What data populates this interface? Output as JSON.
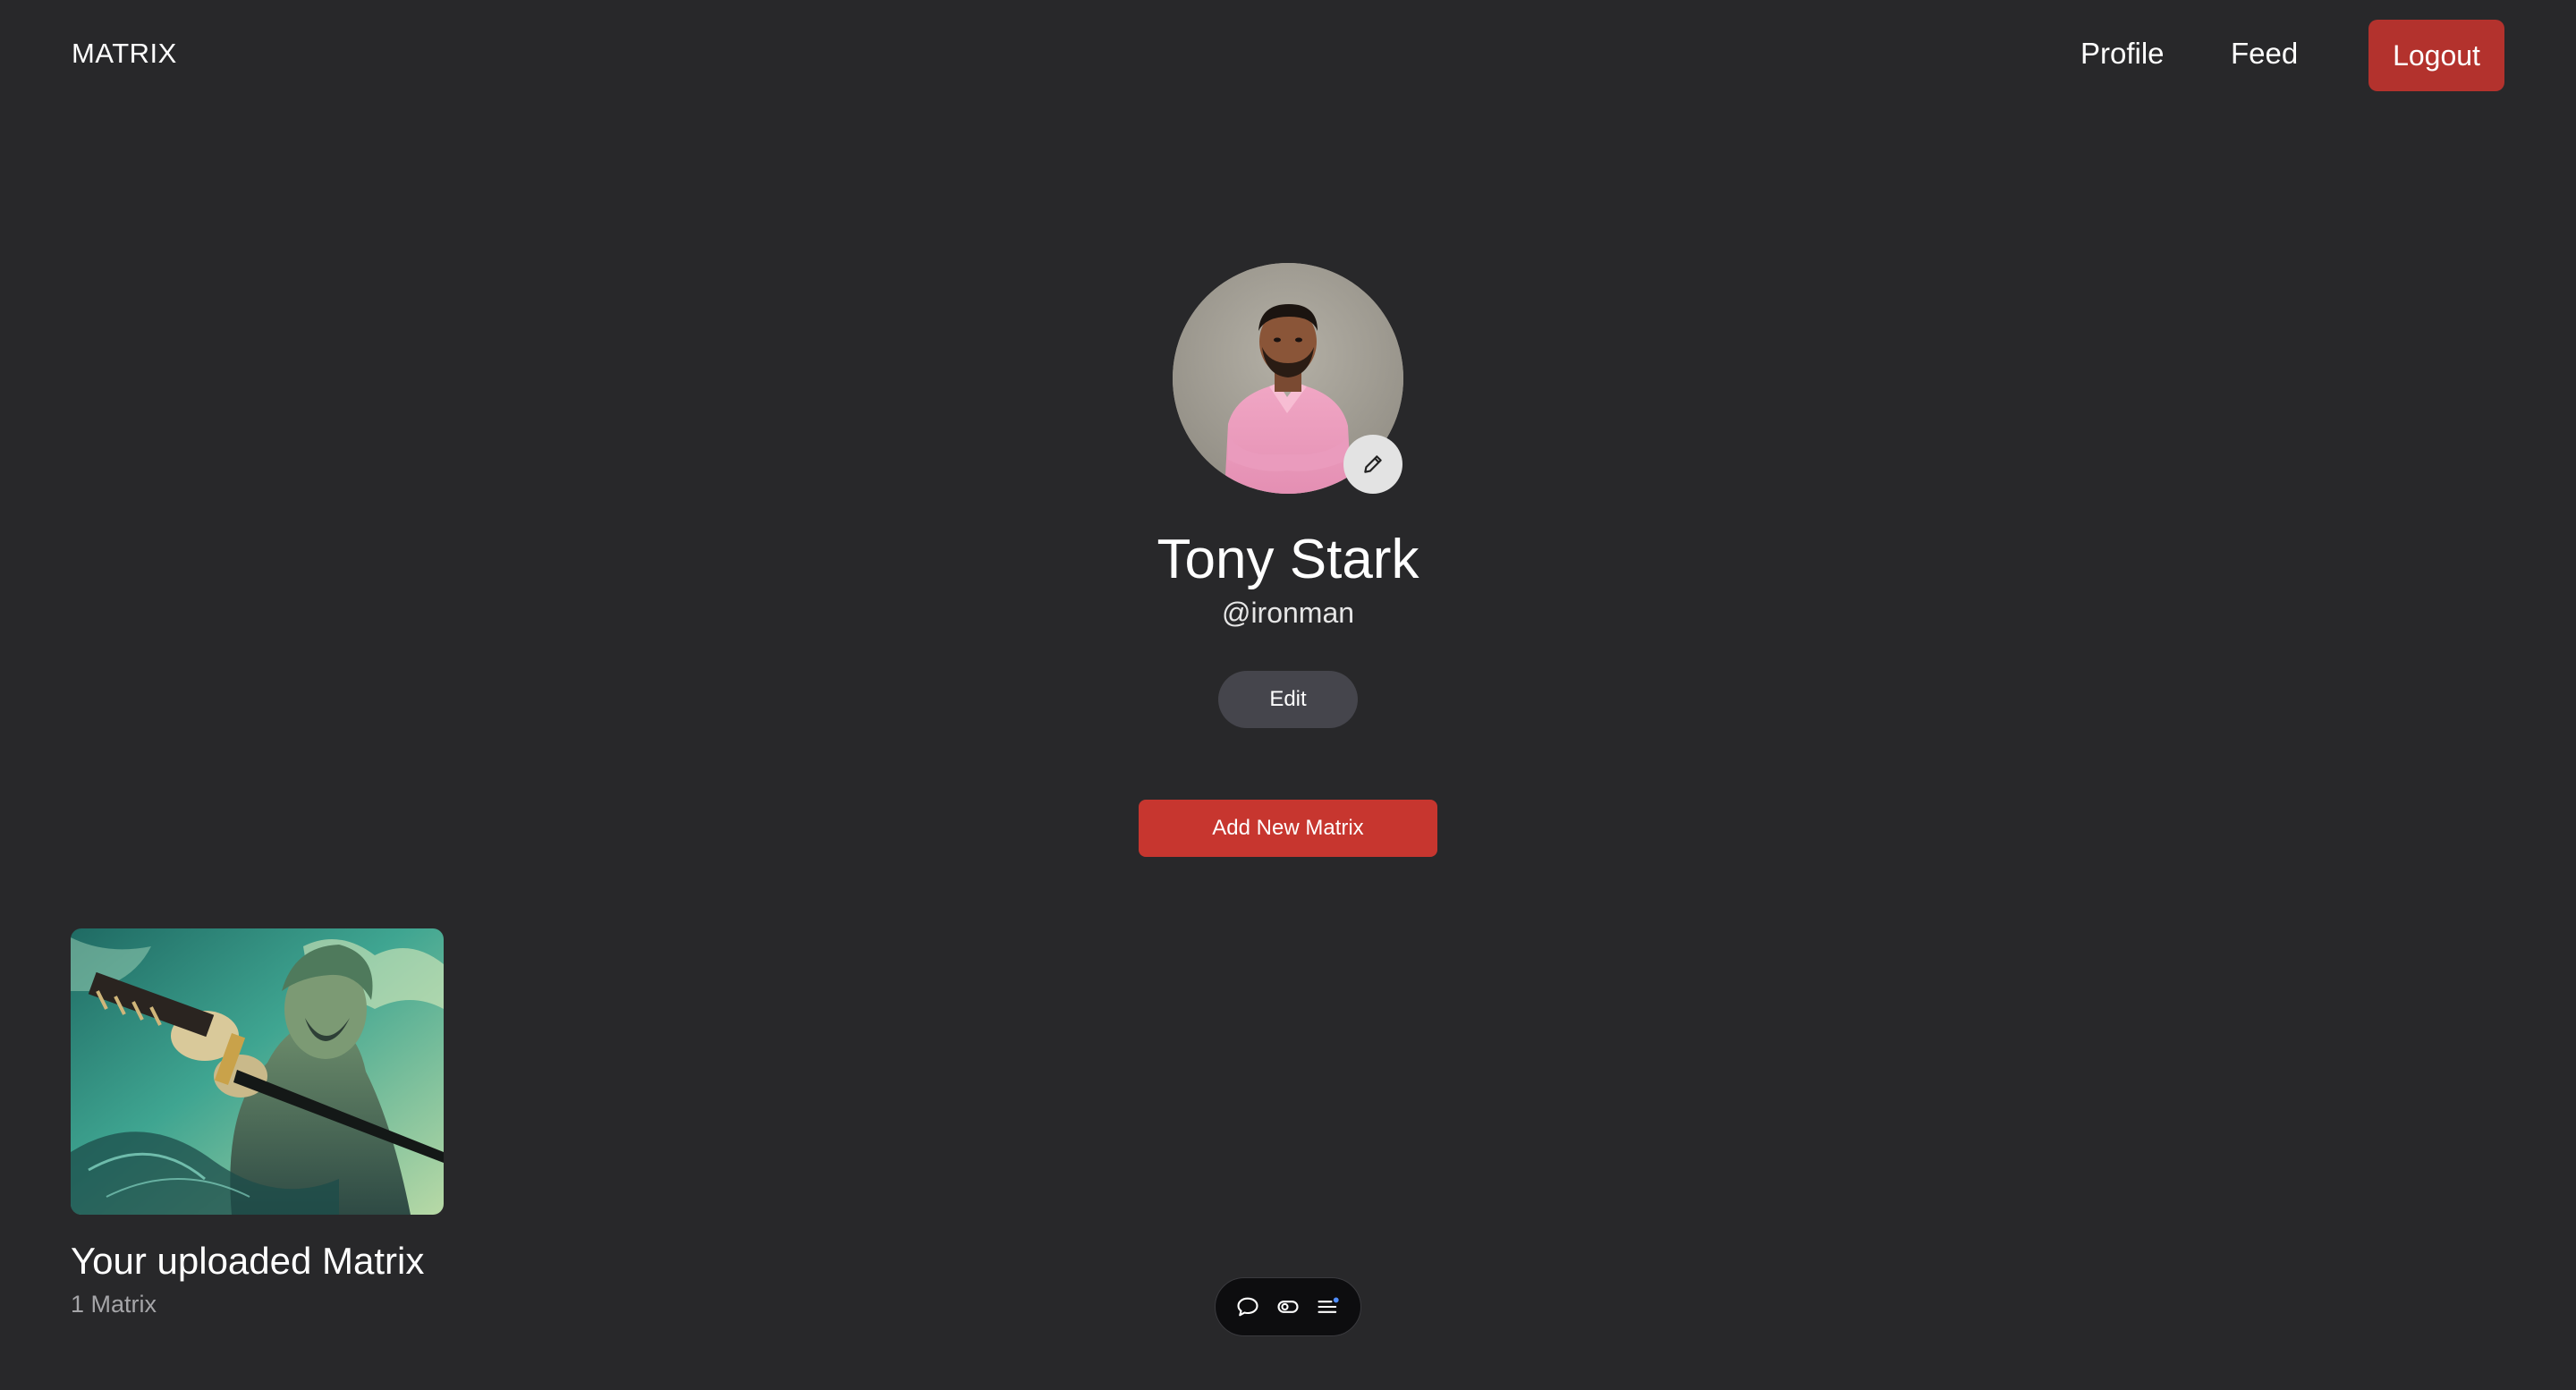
{
  "nav": {
    "brand": "MATRIX",
    "profile_label": "Profile",
    "feed_label": "Feed",
    "logout_label": "Logout"
  },
  "profile": {
    "name": "Tony Stark",
    "username": "@ironman",
    "edit_label": "Edit",
    "add_matrix_label": "Add New Matrix",
    "avatar_icon": "avatar-photo",
    "avatar_edit_icon": "pencil-icon"
  },
  "uploads": {
    "title": "Your uploaded Matrix",
    "count": "1 Matrix",
    "item_icon": "matrix-artwork"
  },
  "toolbar": {
    "icons": [
      "comment-icon",
      "toggle-icon",
      "menu-icon"
    ]
  },
  "colors": {
    "background": "#28282a",
    "accent_red": "#b3322d",
    "add_button": "#c7362f",
    "edit_button": "#45454c",
    "toolbar": "#0d0d0f"
  }
}
